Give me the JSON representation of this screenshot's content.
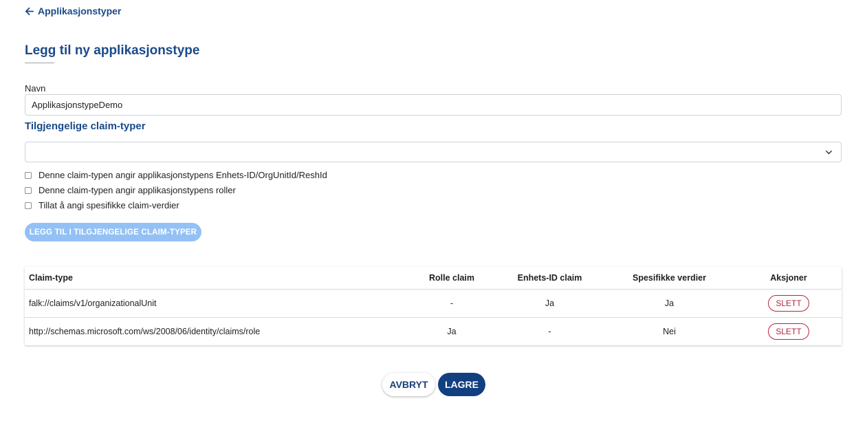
{
  "header": {
    "back_label": "Applikasjonstyper",
    "back_icon": "arrow-left-icon",
    "page_title": "Legg til ny applikasjonstype"
  },
  "form": {
    "name_label": "Navn",
    "name_value": "ApplikasjonstypeDemo",
    "claim_section_title": "Tilgjengelige claim-typer",
    "claim_select_value": "",
    "claim_select_icon": "chevron-down-icon",
    "checkboxes": [
      {
        "label": "Denne claim-typen angir applikasjonstypens Enhets-ID/OrgUnitId/ReshId",
        "checked": false
      },
      {
        "label": "Denne claim-typen angir applikasjonstypens roller",
        "checked": false
      },
      {
        "label": "Tillat å angi spesifikke claim-verdier",
        "checked": false
      }
    ],
    "add_button_label": "LEGG TIL I TILGJENGELIGE CLAIM-TYPER"
  },
  "table": {
    "headers": [
      "Claim-type",
      "Rolle claim",
      "Enhets-ID claim",
      "Spesifikke verdier",
      "Aksjoner"
    ],
    "rows": [
      {
        "claim_type": "falk://claims/v1/organizationalUnit",
        "rolle_claim": "-",
        "enhets_id_claim": "Ja",
        "spesifikke_verdier": "Ja",
        "action_label": "SLETT"
      },
      {
        "claim_type": "http://schemas.microsoft.com/ws/2008/06/identity/claims/role",
        "rolle_claim": "Ja",
        "enhets_id_claim": "-",
        "spesifikke_verdier": "Nei",
        "action_label": "SLETT"
      }
    ]
  },
  "footer": {
    "cancel_label": "AVBRYT",
    "save_label": "LAGRE"
  },
  "colors": {
    "primary": "#123f80",
    "link": "#1a4a8a",
    "disabled_button": "#93c1f5",
    "danger": "#b3243d"
  }
}
